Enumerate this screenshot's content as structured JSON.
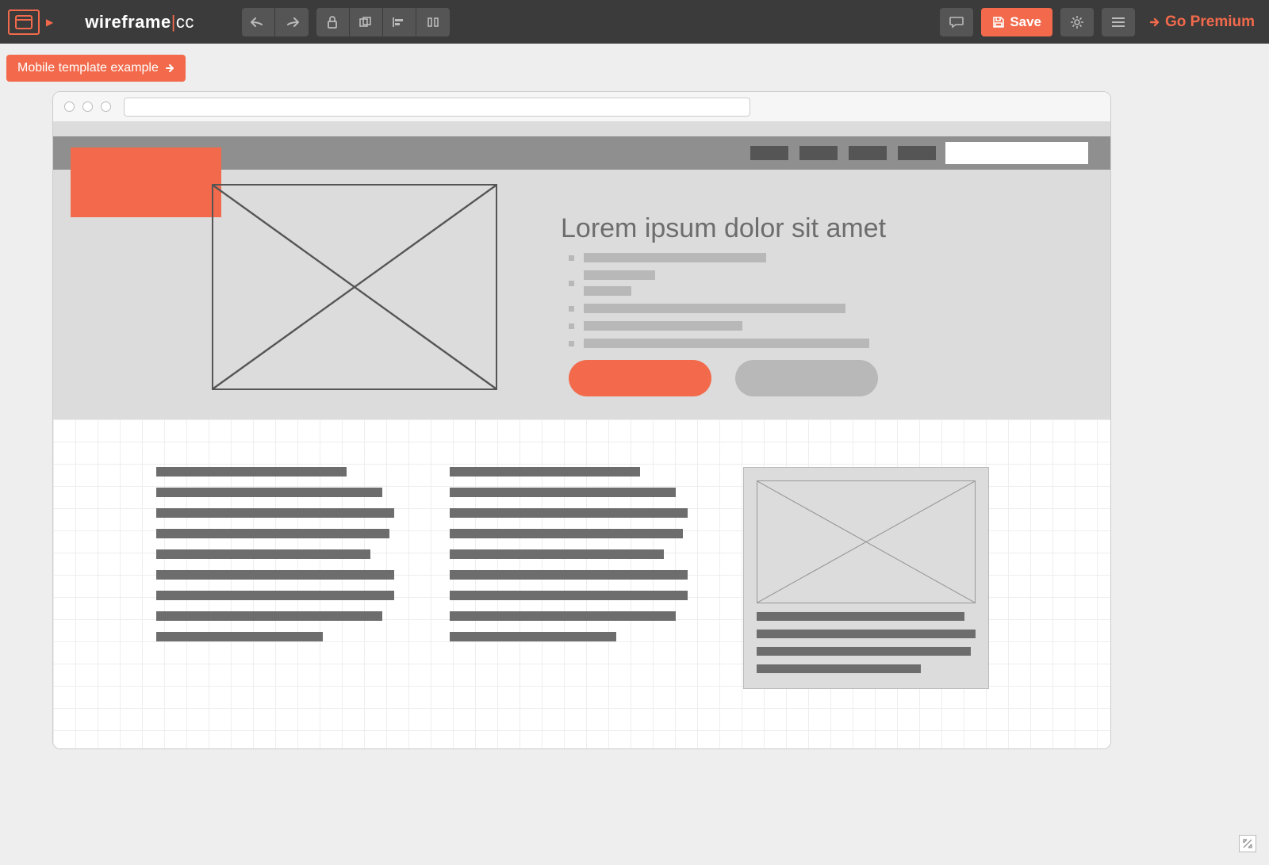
{
  "toolbar": {
    "brand_prefix": "wireframe",
    "brand_suffix": "cc",
    "save_label": "Save",
    "premium_label": "Go Premium"
  },
  "banner": {
    "label": "Mobile template example"
  },
  "hero": {
    "title": "Lorem ipsum dolor sit amet"
  },
  "colors": {
    "accent": "#f26a4b",
    "gray_dark": "#6d6d6d",
    "gray_mid": "#b8b8b8"
  }
}
